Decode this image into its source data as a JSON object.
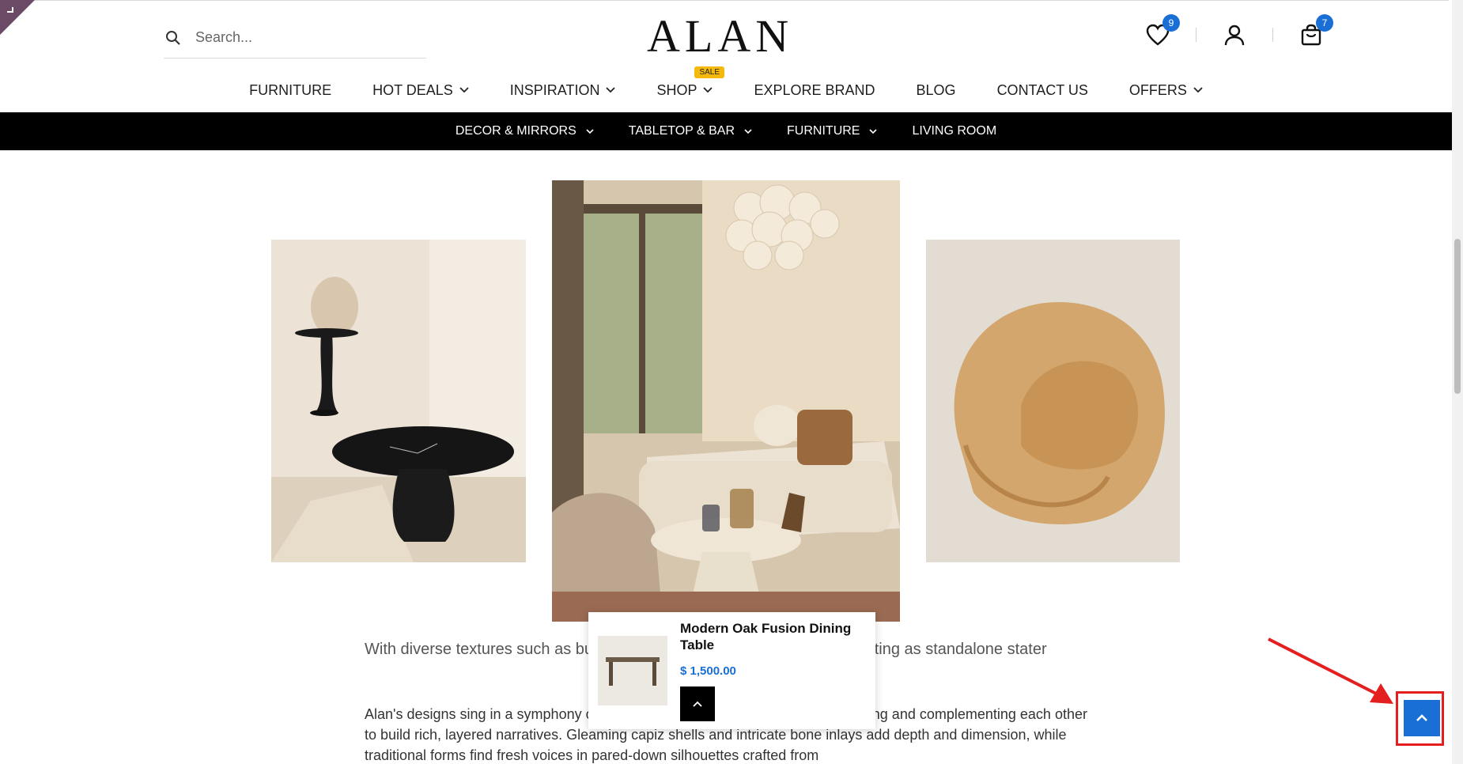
{
  "header": {
    "search_placeholder": "Search...",
    "logo": "ALAN",
    "wishlist_count": "9",
    "cart_count": "7"
  },
  "main_nav": [
    {
      "label": "FURNITURE",
      "has_dropdown": false
    },
    {
      "label": "HOT DEALS",
      "has_dropdown": true
    },
    {
      "label": "INSPIRATION",
      "has_dropdown": true
    },
    {
      "label": "SHOP",
      "has_dropdown": true,
      "badge": "SALE"
    },
    {
      "label": "EXPLORE BRAND",
      "has_dropdown": false
    },
    {
      "label": "BLOG",
      "has_dropdown": false
    },
    {
      "label": "CONTACT US",
      "has_dropdown": false
    },
    {
      "label": "OFFERS",
      "has_dropdown": true
    }
  ],
  "sub_nav": [
    {
      "label": "DECOR & MIRRORS",
      "has_dropdown": true
    },
    {
      "label": "TABLETOP & BAR",
      "has_dropdown": true
    },
    {
      "label": "FURNITURE",
      "has_dropdown": true
    },
    {
      "label": "LIVING ROOM",
      "has_dropdown": false
    }
  ],
  "content": {
    "para1": "With diverse textures such as bur                                                                    furniture complements a room while acting as standalone stater",
    "para2": "Alan's designs sing in a symphony of                                                        to metal, dance in a conversation, contrasting and complementing each other to build rich, layered narratives. Gleaming capiz shells and intricate bone inlays add depth and dimension, while traditional forms find fresh voices in pared-down silhouettes crafted from"
  },
  "popup": {
    "product_title": "Modern Oak Fusion Dining Table",
    "price": "$ 1,500.00"
  },
  "colors": {
    "accent": "#1a6fd6",
    "sale_badge": "#f5b80c",
    "annotation": "#e41f1f"
  }
}
